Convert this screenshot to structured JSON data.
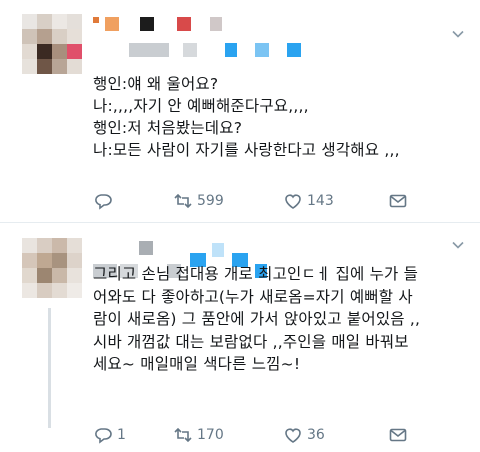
{
  "tweets": [
    {
      "text": "행인:얘 왜 울어요?\n나:,,,,자기 안 예뻐해준다구요,,,,\n행인:저 처음봤는데요?\n나:모든 사람이 자기를 사랑한다고 생각해요 ,,,",
      "reply_count": "",
      "retweet_count": "599",
      "like_count": "143"
    },
    {
      "text": "그리고 손님 접대용 개로 최고인ㄷㅔ 집에 누가 들\n어와도 다 좋아하고(누가 새로옴=자기 예뻐할 사\n람이 새로옴) 그 품안에 가서 앉아있고 붙어있음 ,,\n시바 개껌값 대는 보람없다 ,,주인을 매일 바꿔보\n세요~ 매일매일 색다른 느낌~!",
      "reply_count": "1",
      "retweet_count": "170",
      "like_count": "36"
    }
  ],
  "icons": {
    "reply": "reply-icon",
    "retweet": "retweet-icon",
    "like": "heart-icon",
    "dm": "envelope-icon",
    "caret": "chevron-down-icon"
  },
  "colors": {
    "text": "#14171a",
    "muted": "#657786",
    "divider": "#e6ecf0",
    "blur_blue": "#2aa3f0",
    "blur_gray": "#c9cdd1"
  }
}
